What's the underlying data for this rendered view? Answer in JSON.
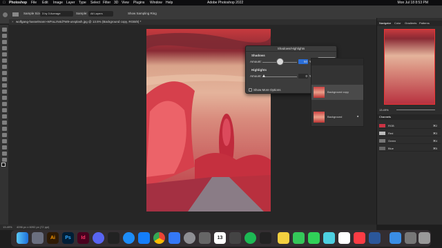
{
  "menubar": {
    "app": "Photoshop",
    "items": [
      "File",
      "Edit",
      "Image",
      "Layer",
      "Type",
      "Select",
      "Filter",
      "3D",
      "View",
      "Plugins",
      "Window",
      "Help"
    ],
    "center_title": "Adobe Photoshop 2022",
    "date_time": "Mon Jul 18 8:53 PM"
  },
  "options": {
    "sample_size_label": "Sample Size:",
    "sample_size_value": "3 by 3 Average",
    "sample_label": "Sample:",
    "sample_value": "All Layers",
    "show_ring_label": "Show Sampling Ring"
  },
  "document": {
    "tab_title": "wolfgang-hasselmann-WFaLzN4d7W8-unsplash.jpg @ 13.5% (Background copy, RGB/8) *",
    "status": "13.49%",
    "status_info": "4096 px x 6092 px (72 ppi)"
  },
  "dialog": {
    "title": "Shadows/Highlights",
    "shadows_label": "Shadows",
    "shadows_amount_label": "Amount:",
    "shadows_amount": "50",
    "highlights_label": "Highlights",
    "highlights_amount_label": "Amount:",
    "highlights_amount": "0",
    "percent": "%",
    "ok": "OK",
    "cancel": "Cancel",
    "load": "Load...",
    "save": "Save...",
    "preview": "Preview",
    "show_more": "Show More Options",
    "shadows_value_fraction": 0.5,
    "highlights_value_fraction": 0.0
  },
  "layers": {
    "items": [
      {
        "name": "Background copy"
      },
      {
        "name": "Background"
      }
    ]
  },
  "navigator": {
    "tabs": [
      "Navigator",
      "Color",
      "Gradients",
      "Patterns"
    ],
    "zoom": "13.49%"
  },
  "channels": {
    "title": "Channels",
    "items": [
      {
        "name": "RGB",
        "shortcut": "⌘2"
      },
      {
        "name": "Red",
        "shortcut": "⌘3"
      },
      {
        "name": "Green",
        "shortcut": "⌘4"
      },
      {
        "name": "Blue",
        "shortcut": "⌘5"
      }
    ]
  },
  "dock": {
    "icons": [
      "finder-icon",
      "launchpad-icon",
      "illustrator-icon",
      "photoshop-icon",
      "indesign-icon",
      "discord-icon",
      "unity-icon",
      "safari-icon",
      "app-store-icon",
      "chrome-icon",
      "settings-icon",
      "mail-icon",
      "calendar-icon",
      "spotify-icon",
      "terminal-icon",
      "notes-icon",
      "messages-icon",
      "facetime-icon",
      "word-icon",
      "folder-icon",
      "trash-icon"
    ],
    "labels": {
      "illustrator": "Ai",
      "photoshop": "Ps",
      "indesign": "Id",
      "calendar": "13"
    }
  }
}
